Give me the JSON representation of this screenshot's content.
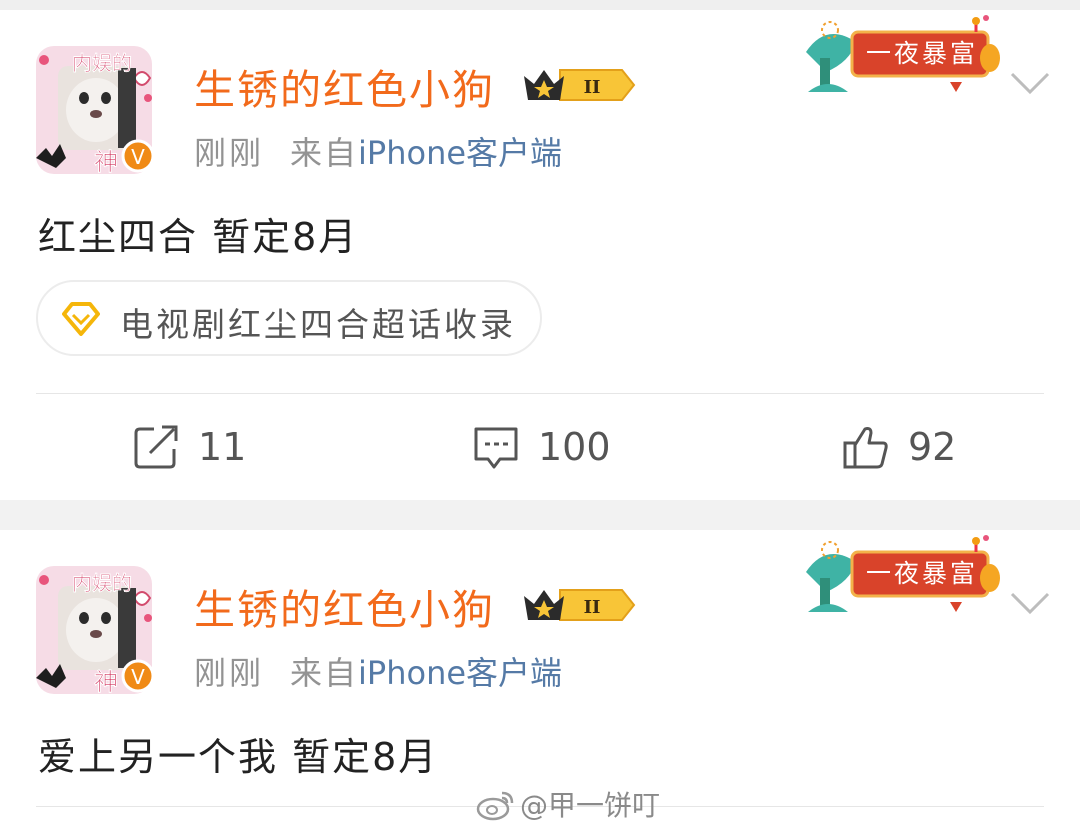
{
  "posts": [
    {
      "username": "生锈的红色小狗",
      "level": "II",
      "avatar_labels": {
        "top": "内娱的",
        "bottom": "神",
        "verified": "V"
      },
      "time": "刚刚",
      "source_prefix": "来自",
      "source_device": "iPhone客户端",
      "decor_label": "一夜暴富",
      "text": "红尘四合 暂定8月",
      "topic": "电视剧红尘四合超话收录",
      "actions": {
        "repost": "11",
        "comment": "100",
        "like": "92"
      }
    },
    {
      "username": "生锈的红色小狗",
      "level": "II",
      "avatar_labels": {
        "top": "内娱的",
        "bottom": "神",
        "verified": "V"
      },
      "time": "刚刚",
      "source_prefix": "来自",
      "source_device": "iPhone客户端",
      "decor_label": "一夜暴富",
      "text": "爱上另一个我 暂定8月"
    }
  ],
  "watermark": "@甲一饼叮",
  "icons": {
    "repost": "repost-icon",
    "comment": "comment-icon",
    "like": "like-icon",
    "more": "chevron-down-icon",
    "topic": "super-topic-diamond-icon",
    "watermark": "weibo-logo-icon"
  },
  "colors": {
    "username": "#f26a1b",
    "device": "#557aa6",
    "meta": "#939393",
    "background": "#f2f2f2"
  }
}
